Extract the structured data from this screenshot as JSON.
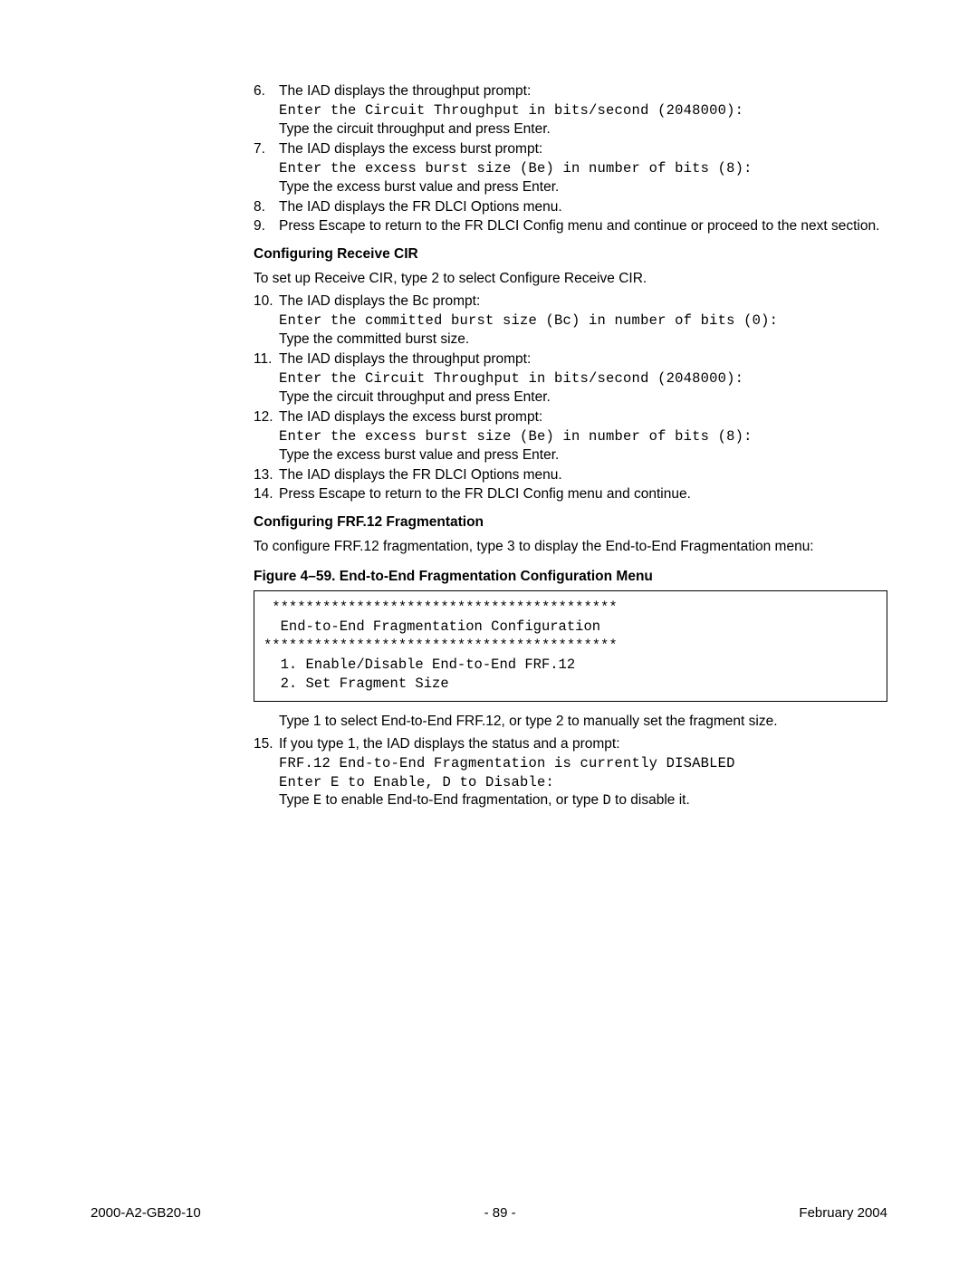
{
  "steps_a": {
    "s6": {
      "num": "6.",
      "l1": "The IAD displays the throughput prompt:",
      "c1": "Enter the Circuit Throughput in bits/second (2048000):",
      "l2": "Type the circuit throughput and press Enter."
    },
    "s7": {
      "num": "7.",
      "l1": "The IAD displays the excess burst prompt:",
      "c1": "Enter the excess burst size (Be) in number of bits (8):",
      "l2": "Type the excess burst value and press Enter."
    },
    "s8": {
      "num": "8.",
      "l1": "The IAD displays the FR DLCI Options menu."
    },
    "s9": {
      "num": "9.",
      "l1": "Press Escape to return to the FR DLCI Config menu and continue or proceed to the next section."
    }
  },
  "sec1": {
    "heading": "Configuring Receive CIR",
    "intro": "To set up Receive CIR, type 2 to select Configure Receive CIR."
  },
  "steps_b": {
    "s10": {
      "num": "10.",
      "l1": "The IAD displays the Bc prompt:",
      "c1": "Enter the committed burst size (Bc) in number of bits (0):",
      "l2": "Type the committed burst size."
    },
    "s11": {
      "num": "11.",
      "l1": "The IAD displays the throughput prompt:",
      "c1": "Enter the Circuit Throughput in bits/second (2048000):",
      "l2": "Type the circuit throughput and press Enter."
    },
    "s12": {
      "num": "12.",
      "l1": "The IAD displays the excess burst prompt:",
      "c1": "Enter the excess burst size (Be) in number of bits (8):",
      "l2": "Type the excess burst value and press Enter."
    },
    "s13": {
      "num": "13.",
      "l1": "The IAD displays the FR DLCI Options menu."
    },
    "s14": {
      "num": "14.",
      "l1": "Press Escape to return to the FR DLCI Config menu and continue."
    }
  },
  "sec2": {
    "heading": "Configuring FRF.12 Fragmentation",
    "intro": "To configure FRF.12 fragmentation, type 3 to display the End-to-End Fragmentation menu:"
  },
  "figure": {
    "title": "Figure 4–59.  End-to-End Fragmentation Configuration Menu",
    "code": " *****************************************\n  End-to-End Fragmentation Configuration\n******************************************\n  1. Enable/Disable End-to-End FRF.12\n  2. Set Fragment Size"
  },
  "after_fig": "Type 1 to select End-to-End FRF.12, or type 2 to manually set the fragment size.",
  "steps_c": {
    "s15": {
      "num": "15.",
      "l1": "If you type 1, the IAD displays the status and a prompt:",
      "c1": "FRF.12 End-to-End Fragmentation is currently DISABLED",
      "c2": "Enter E to Enable, D to Disable:",
      "l2a": "Type ",
      "l2b": "E",
      "l2c": " to enable End-to-End fragmentation, or type ",
      "l2d": "D",
      "l2e": " to disable it."
    }
  },
  "footer": {
    "left": "2000-A2-GB20-10",
    "center": "- 89 -",
    "right": "February 2004"
  }
}
